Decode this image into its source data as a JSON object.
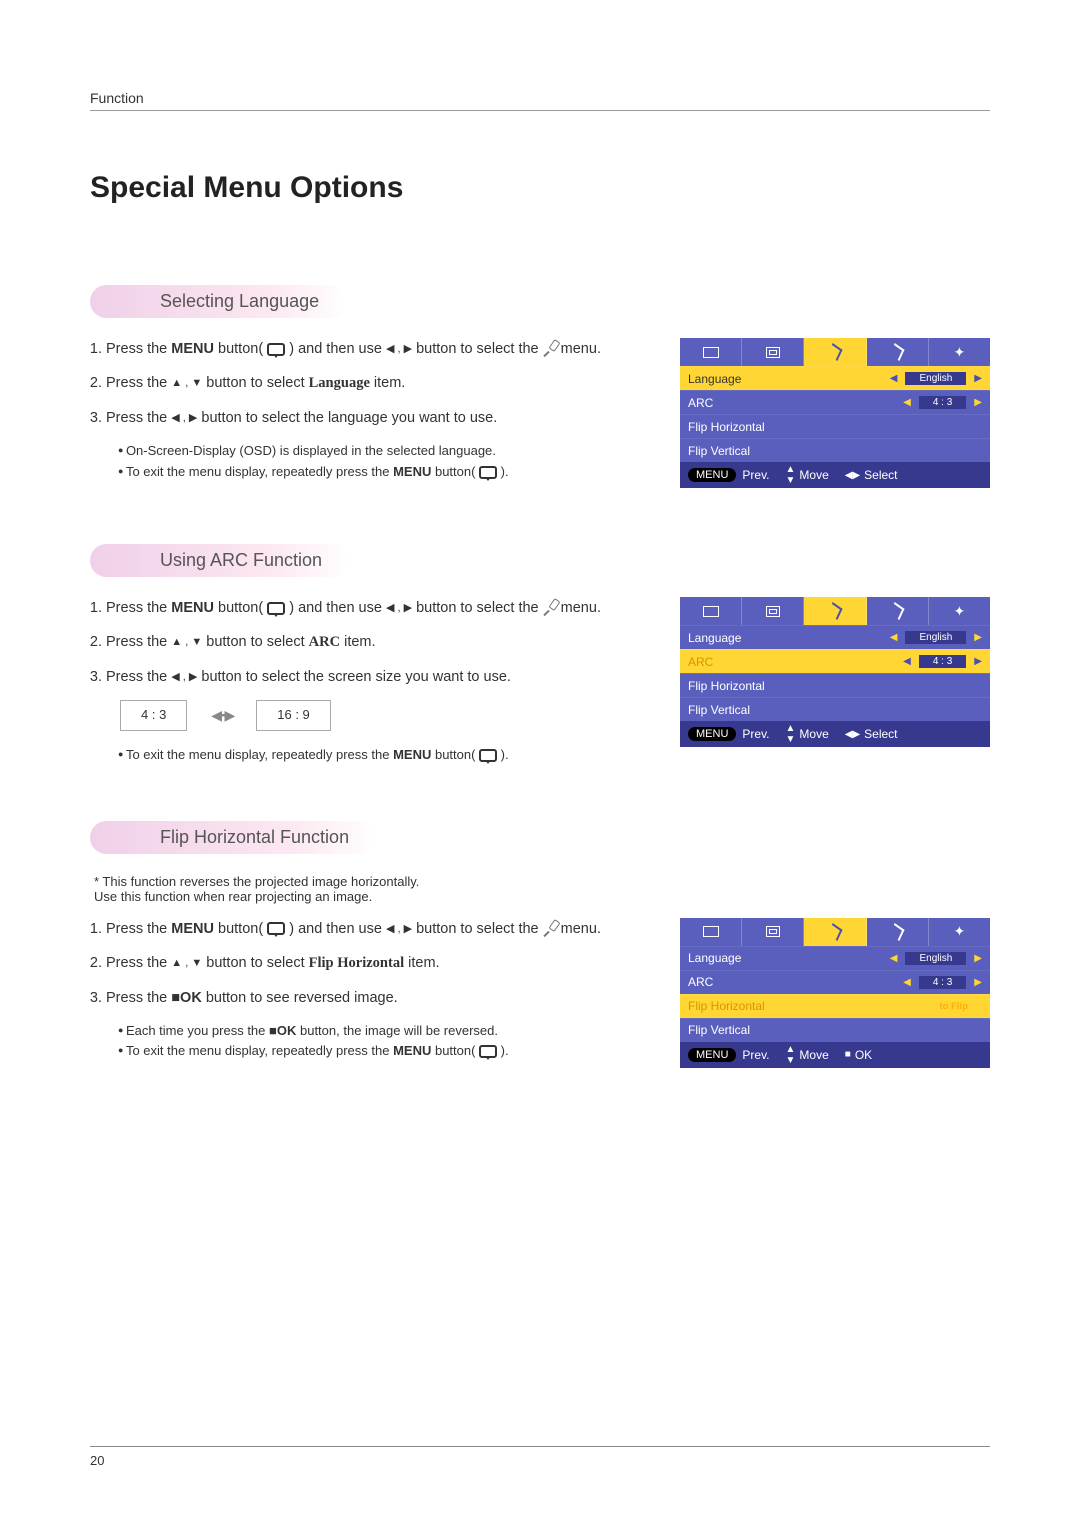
{
  "header": {
    "category": "Function"
  },
  "title": "Special Menu Options",
  "sections": {
    "lang": {
      "heading": "Selecting Language",
      "step1_a": "Press the ",
      "step1_b": "MENU",
      "step1_c": " button( ",
      "step1_d": " ) and then use ",
      "step1_arrows": "◀ , ▶",
      "step1_e": " button to select the ",
      "step1_f": " menu.",
      "step2_a": "Press the ",
      "step2_arrows": "▲ , ▼",
      "step2_b": " button to select ",
      "step2_item": "Language",
      "step2_c": " item.",
      "step3_a": "Press the ",
      "step3_arrows": "◀ , ▶",
      "step3_b": " button to select the language you want to use.",
      "bullet1": "On-Screen-Display (OSD) is displayed in the selected language.",
      "bullet2_a": "To exit the menu display, repeatedly press the ",
      "bullet2_b": "MENU",
      "bullet2_c": " button( ",
      "bullet2_d": " )."
    },
    "arc": {
      "heading": "Using ARC Function",
      "step2_item": "ARC",
      "step3_b": " button to select the screen size you want to use.",
      "ratio1": "4 : 3",
      "ratio2": "16 : 9"
    },
    "flip": {
      "heading": "Flip Horizontal Function",
      "note1": "* This function reverses the projected image horizontally.",
      "note2": "  Use this function when rear projecting an image.",
      "step2_item": "Flip Horizontal",
      "step3_a": "Press the ",
      "step3_btn": "■OK",
      "step3_b": " button to see reversed image.",
      "bullet1_a": "Each time you press the ",
      "bullet1_b": "■OK",
      "bullet1_c": " button, the image will be reversed."
    }
  },
  "osd": {
    "labels": {
      "language": "Language",
      "arc": "ARC",
      "fliph": "Flip Horizontal",
      "flipv": "Flip Vertical"
    },
    "values": {
      "english": "English",
      "ratio": "4 : 3",
      "toflip": "to Flip"
    },
    "footer": {
      "menu": "MENU",
      "prev": "Prev.",
      "move": "Move",
      "select": "Select",
      "ok": "OK"
    }
  },
  "page_number": "20"
}
